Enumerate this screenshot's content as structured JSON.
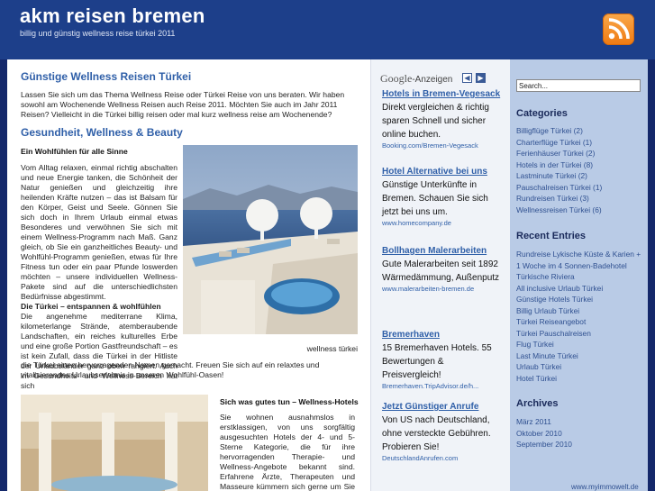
{
  "site": {
    "title": "akm reisen bremen",
    "tagline": "billig und günstig wellness reise türkei 2011",
    "rss_icon": "rss-feed-icon"
  },
  "post": {
    "title": "Günstige Wellness Reisen Türkei",
    "intro": "Lassen Sie sich um das Thema Wellness Reise oder Türkei Reise von uns beraten. Wir haben sowohl am Wochenende Wellness Reisen auch Reise 2011. Möchten Sie auch im Jahr 2011 Reisen? Vielleicht in die Türkei billig reisen oder mal kurz wellness reise am Wochenende?",
    "subtitle": "Gesundheit, Wellness & Beauty",
    "bold_heading": "Ein Wohlfühlen für alle Sinne",
    "column_text": "Vom Alltag relaxen, einmal richtig abschalten und neue Energie tanken, die Schönheit der Natur genießen und gleichzeitig ihre heilenden Kräfte nutzen – das ist Balsam für den Körper, Geist und Seele. Gönnen Sie sich doch in Ihrem Urlaub einmal etwas Besonderes und verwöhnen Sie sich mit einem Wellness-Programm nach Maß. Ganz gleich, ob Sie ein ganzheitliches Beauty- und Wohlfühl-Programm genießen, etwas für Ihre Fitness tun oder ein paar Pfunde loswerden möchten – unsere individuellen Wellness-Pakete sind auf die unterschiedlichsten Bedürfnisse abgestimmt.",
    "column_highlight": "Die Türkei – entspannen & wohlfühlen",
    "column_text2": "Die angenehme mediterrane Klima, kilometerlange Strände, atemberaubende Landschaften, ein reiches kulturelles Erbe und eine große Portion Gastfreundschaft – es ist kein Zufall, dass die Türkei in der Hitliste der Urlaubsländer ganz oben rangiert. Auch im Gesundheits- und Wellness-Bereich hat sich",
    "full_text": "die Türkei einen hervorragenden Namen gemacht. Freuen Sie sich auf ein relaxtes und vitalisierendes Urlaubserlebnis in unseren Wohlfühl-Oasen!",
    "image_caption": "wellness türkei",
    "bold_heading2": "Sich was gutes tun – Wellness-Hotels",
    "column2_text": "Sie wohnen ausnahmslos in erstklassigen, von uns sorgfältig ausgesuchten Hotels der 4- und 5-Sterne Kategorie, die für ihre hervorragenden Therapie- und Wellness-Angebote bekannt sind. Erfahrene Ärzte, Therapeuten und Masseure kümmern sich gerne um Sie und sorgen dafür, dass"
  },
  "ads": {
    "google_label": "Google",
    "ads_label": "-Anzeigen",
    "prev_label": "◀",
    "next_label": "▶",
    "items": [
      {
        "title": "Hotels in Bremen-Vegesack",
        "body": "Direkt vergleichen & richtig sparen Schnell und sicher online buchen.",
        "url": "Booking.com/Bremen-Vegesack"
      },
      {
        "title": "Hotel Alternative bei uns",
        "body": "Günstige Unterkünfte in Bremen. Schauen Sie sich jetzt bei uns um.",
        "url": "www.homecompany.de"
      },
      {
        "title": "Bollhagen Malerarbeiten",
        "body": "Gute Malerarbeiten seit 1892 Wärmedämmung, Außenputz",
        "url": "www.malerarbeiten-bremen.de"
      },
      {
        "title": "Bremerhaven",
        "body": "15 Bremerhaven Hotels. 55 Bewertungen & Preisvergleich!",
        "url": "Bremerhaven.TripAdvisor.de/h..."
      },
      {
        "title": "Jetzt Günstiger Anrufe",
        "body": "Von US nach Deutschland, ohne versteckte Gebühren. Probieren Sie!",
        "url": "DeutschlandAnrufen.com"
      }
    ]
  },
  "sidebar": {
    "search_value": "Search...",
    "categories_title": "Categories",
    "categories": [
      "Billigflüge Türkei (2)",
      "Charterflüge Türkei (1)",
      "Ferienhäuser Türkei (2)",
      "Hotels in der Türkei (8)",
      "Lastminute Türkei (2)",
      "Pauschalreisen Türkei (1)",
      "Rundreisen Türkei (3)",
      "Wellnessreisen Türkei (6)"
    ],
    "recent_title": "Recent Entries",
    "recent": [
      "Rundreise Lykische Küste & Karien +",
      "1 Woche im 4 Sonnen-Badehotel",
      "Türkische Riviera",
      "All inclusive Urlaub Türkei",
      "Günstige Hotels Türkei",
      "Billig Urlaub Türkei",
      "Türkei Reiseangebot",
      "Türkei Pauschalreisen",
      "Flug Türkei",
      "Last Minute Türkei",
      "Urlaub Türkei",
      "Hotel Türkei"
    ],
    "archives_title": "Archives",
    "archives": [
      "März 2011",
      "Oktober 2010",
      "September 2010"
    ],
    "bottom_url": "www.myimmowelt.de"
  }
}
